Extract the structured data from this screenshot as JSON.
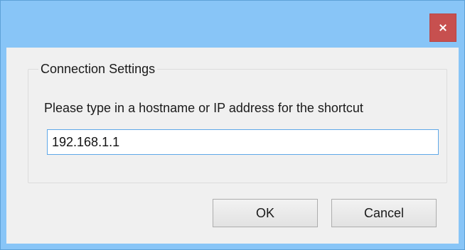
{
  "window": {
    "close_icon": "close-icon",
    "close_color": "#c7504f",
    "frame_color": "#88c5f7"
  },
  "group": {
    "legend": "Connection Settings",
    "prompt": "Please type in a hostname or IP address for the shortcut"
  },
  "host_input": {
    "value": "192.168.1.1"
  },
  "buttons": {
    "ok_label": "OK",
    "cancel_label": "Cancel"
  }
}
